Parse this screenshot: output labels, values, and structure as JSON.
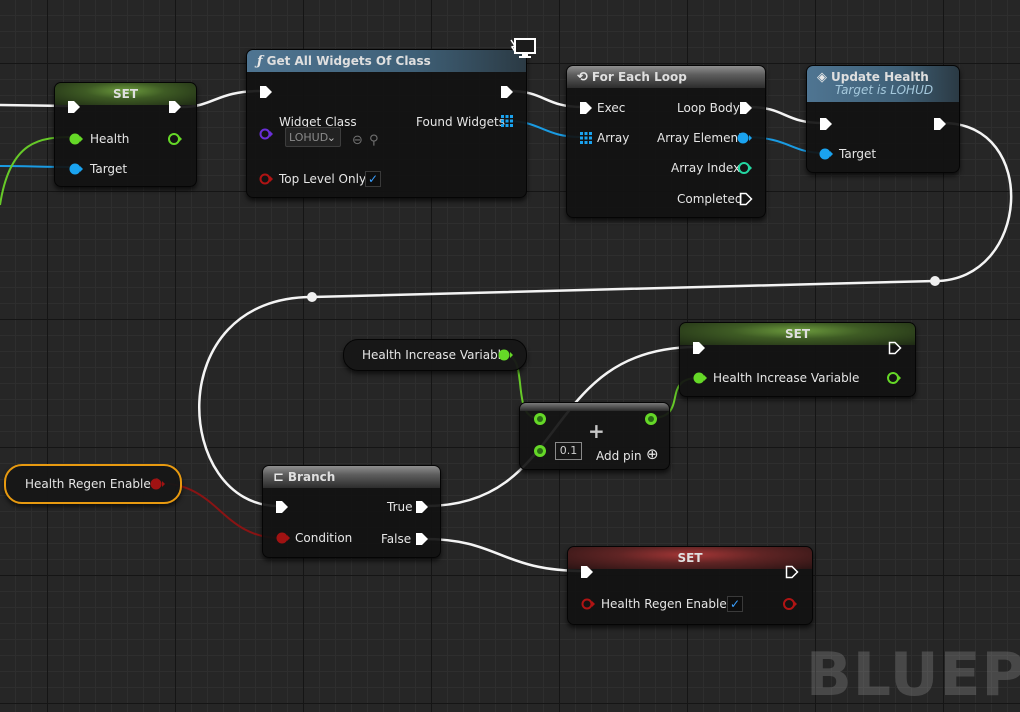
{
  "watermark": "BLUEPRI",
  "nodes": {
    "set_health": {
      "title": "SET",
      "pins": {
        "health": "Health",
        "target": "Target"
      }
    },
    "get_widgets": {
      "title": "Get All Widgets Of Class",
      "pins": {
        "widget_class": "Widget Class",
        "found_widgets": "Found Widgets",
        "top_level_only": "Top Level Only"
      },
      "widget_class_value": "LOHUD",
      "top_level_only_checked": true
    },
    "for_each": {
      "title": "For Each Loop",
      "pins": {
        "exec": "Exec",
        "array": "Array",
        "loop_body": "Loop Body",
        "array_element": "Array Element",
        "array_index": "Array Index",
        "completed": "Completed"
      }
    },
    "update_health": {
      "title": "Update Health",
      "subtitle": "Target is LOHUD",
      "pins": {
        "target": "Target"
      }
    },
    "health_increase_get": {
      "label": "Health Increase Variable"
    },
    "add": {
      "value": "0.1",
      "add_pin": "Add pin"
    },
    "set_health_increase": {
      "title": "SET",
      "pins": {
        "var": "Health Increase Variable"
      }
    },
    "health_regen_get": {
      "label": "Health Regen Enabled"
    },
    "branch": {
      "title": "Branch",
      "pins": {
        "condition": "Condition",
        "true": "True",
        "false": "False"
      }
    },
    "set_regen": {
      "title": "SET",
      "pins": {
        "var": "Health Regen Enabled"
      },
      "checked": true
    }
  },
  "colors": {
    "exec": "#ffffff",
    "float": "#7ff24a",
    "object": "#1aa3f0",
    "bool": "#9a1010",
    "integer": "#24d7a2",
    "class": "#6a2fd8"
  },
  "icons": {
    "function": "function-icon",
    "loop": "loop-icon",
    "event": "event-diamond-icon",
    "branch": "branch-icon",
    "add": "plus-icon",
    "monitor": "monitor-icon"
  }
}
